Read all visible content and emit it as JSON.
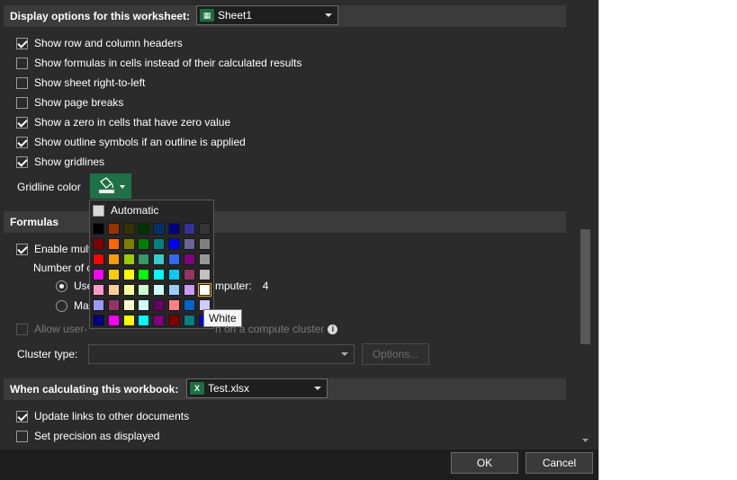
{
  "display": {
    "header": "Display options for this worksheet:",
    "sheet_select": "Sheet1",
    "options": [
      {
        "label": "Show row and column headers",
        "checked": true
      },
      {
        "label": "Show formulas in cells instead of their calculated results",
        "checked": false
      },
      {
        "label": "Show sheet right-to-left",
        "checked": false
      },
      {
        "label": "Show page breaks",
        "checked": false
      },
      {
        "label": "Show a zero in cells that have zero value",
        "checked": true
      },
      {
        "label": "Show outline symbols if an outline is applied",
        "checked": true
      },
      {
        "label": "Show gridlines",
        "checked": true
      }
    ],
    "gridline_color_label": "Gridline color"
  },
  "palette": {
    "automatic_label": "Automatic",
    "tooltip": "White",
    "colors": [
      [
        "#000000",
        "#993300",
        "#333300",
        "#003300",
        "#003366",
        "#000080",
        "#333399",
        "#333333"
      ],
      [
        "#800000",
        "#FF6600",
        "#808000",
        "#008000",
        "#008080",
        "#0000FF",
        "#666699",
        "#808080"
      ],
      [
        "#FF0000",
        "#FF9900",
        "#99CC00",
        "#339966",
        "#33CCCC",
        "#3366FF",
        "#800080",
        "#969696"
      ],
      [
        "#FF00FF",
        "#FFCC00",
        "#FFFF00",
        "#00FF00",
        "#00FFFF",
        "#00CCFF",
        "#993366",
        "#C0C0C0"
      ],
      [
        "#FF99CC",
        "#FFCC99",
        "#FFFF99",
        "#CCFFCC",
        "#CCFFFF",
        "#99CCFF",
        "#CC99FF",
        "#FFFFFF"
      ],
      [
        "#9999FF",
        "#993366",
        "#FFFFCC",
        "#CCFFFF",
        "#660066",
        "#FF8080",
        "#0066CC",
        "#CCCCFF"
      ],
      [
        "#000080",
        "#FF00FF",
        "#FFFF00",
        "#00FFFF",
        "#800080",
        "#800000",
        "#008080",
        "#0000FF"
      ]
    ],
    "selected": "#FFFFFF"
  },
  "formulas": {
    "header": "Formulas",
    "enable_label": "Enable mult",
    "number_of_label": "Number of c",
    "use_label": "Use",
    "computer_label": "mputer:",
    "computer_value": "4",
    "manual_label": "Ma",
    "allow_label": "Allow user-",
    "compute_cluster_label": "n on a compute cluster",
    "cluster_type_label": "Cluster type:",
    "options_button": "Options..."
  },
  "workbook": {
    "header": "When calculating this workbook:",
    "file_select": "Test.xlsx",
    "options": [
      {
        "label": "Update links to other documents",
        "checked": true
      },
      {
        "label": "Set precision as displayed",
        "checked": false
      }
    ]
  },
  "footer": {
    "ok": "OK",
    "cancel": "Cancel"
  },
  "colors": {
    "dialog_bg": "#2b2b2b",
    "section_bg": "#3b3b3b",
    "accent_green": "#1e7145"
  }
}
